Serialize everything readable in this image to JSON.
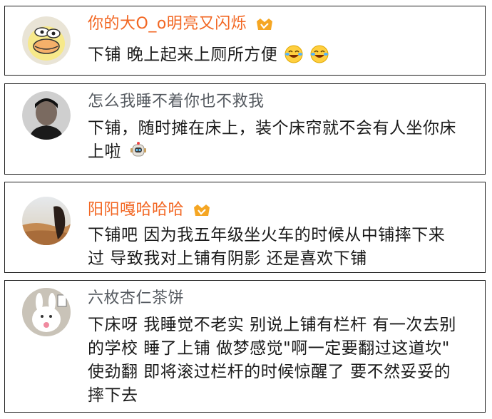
{
  "comments": [
    {
      "username": "你的大O_o明亮又闪烁",
      "lines": [
        "下铺 晚上起来上厕所方便"
      ],
      "emojis": [
        "laugh-cry-emoji",
        "laugh-cry-emoji"
      ],
      "name_color": "#f26622"
    },
    {
      "username": "怎么我睡不着你也不救我",
      "lines": [
        "下铺，随时摊在床上，装个床帘就不会有人坐你床",
        "上啦"
      ],
      "emojis": [
        "robot-emoji"
      ],
      "name_color": "#555a60"
    },
    {
      "username": "阳阳嘎哈哈哈",
      "lines": [
        "下铺吧 因为我五年级坐火车的时候从中铺摔下来",
        "过 导致我对上铺有阴影 还是喜欢下铺"
      ],
      "name_color": "#f26622"
    },
    {
      "username": "六枚杏仁茶饼",
      "lines": [
        "下床呀 我睡觉不老实 别说上铺有栏杆 有一次去别",
        "的学校 睡了上铺 做梦感觉\"啊一定要翻过这道坎\"",
        "使劲翻 即将滚过栏杆的时候惊醒了 要不然妥妥的",
        "摔下去"
      ],
      "name_color": "#555a60"
    }
  ]
}
